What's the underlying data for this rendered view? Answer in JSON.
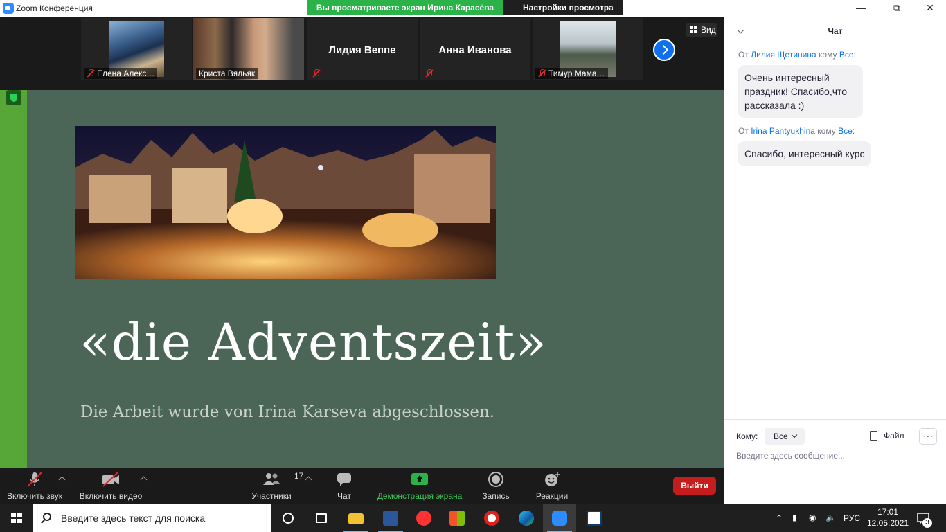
{
  "window": {
    "title": "Zoom Конференция",
    "share_banner": "Вы просматриваете экран Ирина Карасёва",
    "view_settings": "Настройки просмотра"
  },
  "gallery": {
    "tiles": [
      {
        "name": "Елена Алекс…",
        "video": true,
        "muted": true
      },
      {
        "name": "Криста Вяльяк",
        "video": true,
        "muted": false
      },
      {
        "name": "Лидия Веппе",
        "video": false,
        "muted": true
      },
      {
        "name": "Анна Иванова",
        "video": false,
        "muted": true
      },
      {
        "name": "Тимур Мама…",
        "video": true,
        "muted": true
      }
    ],
    "view_label": "Вид"
  },
  "slide": {
    "title": "«die Adventszeit»",
    "subtitle": "Die Arbeit wurde von Irina Karseva abgeschlossen."
  },
  "toolbar": {
    "audio": "Включить звук",
    "video": "Включить видео",
    "participants": "Участники",
    "participants_count": "17",
    "chat": "Чат",
    "share": "Демонстрация экрана",
    "record": "Запись",
    "reactions": "Реакции",
    "leave": "Выйти"
  },
  "chat": {
    "title": "Чат",
    "messages": [
      {
        "from_prefix": "От",
        "from": "Лилия Щетинина",
        "to_prefix": "кому",
        "to": "Все:",
        "text": "Очень интересный праздник! Спасибо,что рассказала :)"
      },
      {
        "from_prefix": "От",
        "from": "Irina Pantyukhina",
        "to_prefix": "кому",
        "to": "Все:",
        "text": "Спасибо, интересный курс"
      }
    ],
    "to_label": "Кому:",
    "to_value": "Все",
    "file_label": "Файл",
    "more_label": "···",
    "input_placeholder": "Введите здесь сообщение..."
  },
  "taskbar": {
    "search_placeholder": "Введите здесь текст для поиска",
    "lang": "РУС",
    "time": "17:01",
    "date": "12.05.2021",
    "notifications": "3"
  },
  "colors": {
    "accent": "#0e71eb",
    "share_green": "#2bb34a",
    "slide_bg": "#4b6556",
    "leave_red": "#c51d1d"
  }
}
